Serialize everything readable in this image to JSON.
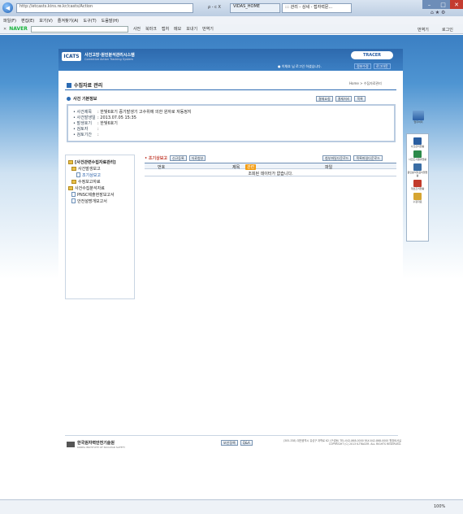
{
  "browser": {
    "url": "http://etcasts.kins.re.kr/casts/Action",
    "tabs": [
      {
        "label": "VIDAS_HOME"
      },
      {
        "label": "::: 관리 - 상세 - 접자력문... "
      }
    ],
    "search_hint": "ρ - c X",
    "menu": [
      "파일(F)",
      "편집(E)",
      "보기(V)",
      "즐겨찾기(A)",
      "도구(T)",
      "도움말(H)"
    ],
    "toolbar": {
      "brand": "NAVER",
      "items": [
        "사전",
        "북마크",
        "캡처",
        "메모",
        "보내기",
        "번역기"
      ],
      "right_items": [
        "번역기",
        "로그인"
      ]
    },
    "zoom": "100%"
  },
  "header": {
    "logo": "ICATS",
    "logo_title": "사건고장·원인분석관리시스템",
    "logo_sub": "Corrective Action Tracking System",
    "user_msg": "● 이채호 님 로그인 하셨습니다.",
    "btn_mypage": "정보수정",
    "btn_logout": "로그아웃",
    "brand_right": "TRACER"
  },
  "page": {
    "title": "수집자료 관리",
    "breadcrumb": "Home > 수집자료관리",
    "section_title": "사건 기본정보",
    "section_buttons": [
      "결재요청",
      "결재처리",
      "목록"
    ],
    "info_rows": [
      {
        "label": "• 사건제목",
        "value": ": 한빛6호기 증기발생기 고수위에 의한 원자로 자동정지"
      },
      {
        "label": "• 사건발생일",
        "value": ": 2013.07.05 15:35"
      },
      {
        "label": "• 발생호기",
        "value": ": 한빛6호기"
      },
      {
        "label": "• 검토자",
        "value": ":"
      },
      {
        "label": "• 검토기간",
        "value": ":"
      }
    ]
  },
  "tree": {
    "root": "[사건관련수집자료관리]",
    "items": [
      {
        "label": "사건발생보고",
        "kind": "folder"
      },
      {
        "label": "조기상보고",
        "kind": "doc"
      },
      {
        "label": "수정보고자료",
        "kind": "folder"
      },
      {
        "label": "사건수집분석자료",
        "kind": "folder"
      },
      {
        "label": "PNSC제출현장보고서",
        "kind": "doc"
      },
      {
        "label": "안전설명개보고서",
        "kind": "doc"
      }
    ]
  },
  "table": {
    "label": "• 조기상보고",
    "buttons": [
      "신규등록",
      "자료첨부"
    ],
    "right_buttons": [
      "첨부파일다운로드",
      "목록파일다운로드"
    ],
    "columns": [
      "번호",
      "제목",
      "파일"
    ],
    "badge": "관련",
    "empty_message": "조회된 데이터가 없습니다."
  },
  "side_panel": {
    "items": [
      {
        "label": "업무처리",
        "color": "#4d7fb3"
      },
      {
        "label": "사건관리현황",
        "color": "#2a5ea0"
      },
      {
        "label": "사건조사결과현황",
        "color": "#2c8a4a"
      },
      {
        "label": "원인분석자료이행현황",
        "color": "#3b6ea5"
      },
      {
        "label": "개선조치현황",
        "color": "#c23b2b"
      },
      {
        "label": "수집자료",
        "color": "#d6a531"
      }
    ]
  },
  "footer": {
    "org": "한국원자력안전기술원",
    "org_sub": "KOREA INSTITUTE OF NUCLEAR SAFETY",
    "buttons": [
      "보안정책",
      "Q&A"
    ],
    "address": "(305-338) 대전광역시 유성구 과학로 62 (구성동) TEL:042-868-0000 FAX:042-868-0000 원장비서실",
    "copyright": "COPYRIGHT (C) 2013 K-TRACER. ALL RIGHTS RESERVED."
  }
}
